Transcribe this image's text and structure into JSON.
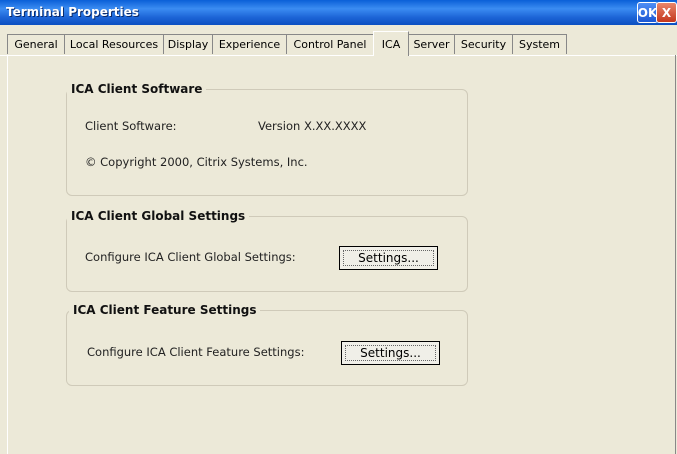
{
  "window": {
    "title": "Terminal Properties",
    "ok_label": "OK",
    "close_label": "X"
  },
  "tabs": [
    {
      "label": "General"
    },
    {
      "label": "Local Resources"
    },
    {
      "label": "Display"
    },
    {
      "label": "Experience"
    },
    {
      "label": "Control Panel"
    },
    {
      "label": "ICA",
      "active": true
    },
    {
      "label": "Server"
    },
    {
      "label": "Security"
    },
    {
      "label": "System"
    }
  ],
  "software_group": {
    "title": "ICA Client Software",
    "client_software_label": "Client Software:",
    "version_value": "Version X.XX.XXXX",
    "copyright": "© Copyright 2000, Citrix Systems, Inc."
  },
  "global_group": {
    "title": "ICA Client Global Settings",
    "configure_label": "Configure ICA Client Global Settings:",
    "button_label": "Settings..."
  },
  "feature_group": {
    "title": "ICA Client Feature Settings",
    "configure_label": "Configure ICA Client Feature Settings:",
    "button_label": "Settings..."
  }
}
